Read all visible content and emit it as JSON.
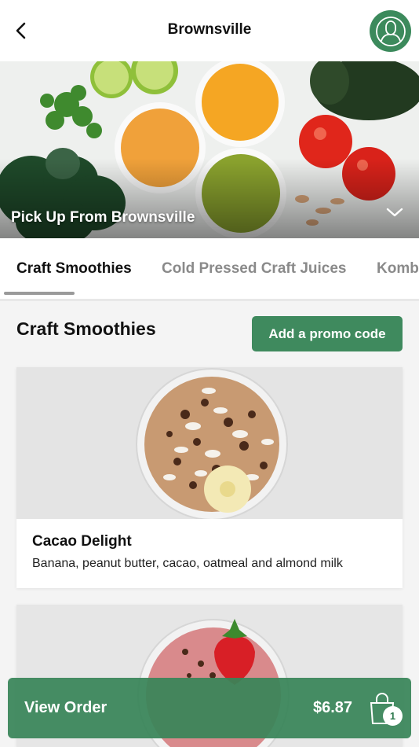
{
  "header": {
    "title": "Brownsville",
    "back_icon": "chevron-left-icon",
    "profile_icon": "user-icon"
  },
  "hero": {
    "caption": "Pick Up From Brownsville",
    "expand_icon": "chevron-down-icon"
  },
  "tabs": [
    {
      "label": "Craft Smoothies",
      "active": true
    },
    {
      "label": "Cold Pressed Craft Juices",
      "active": false
    },
    {
      "label": "Kombucha",
      "active": false
    }
  ],
  "section": {
    "title": "Craft Smoothies",
    "promo_label": "Add a promo code"
  },
  "products": [
    {
      "name": "Cacao Delight",
      "description": "Banana, peanut butter, cacao, oatmeal and almond milk"
    },
    {
      "name": "",
      "description": ""
    }
  ],
  "order": {
    "label": "View Order",
    "total": "$6.87",
    "item_count": "1",
    "bag_icon": "shopping-bag-icon"
  },
  "colors": {
    "brand_green": "#3f8a5e",
    "tab_inactive": "#8a8a8a"
  }
}
